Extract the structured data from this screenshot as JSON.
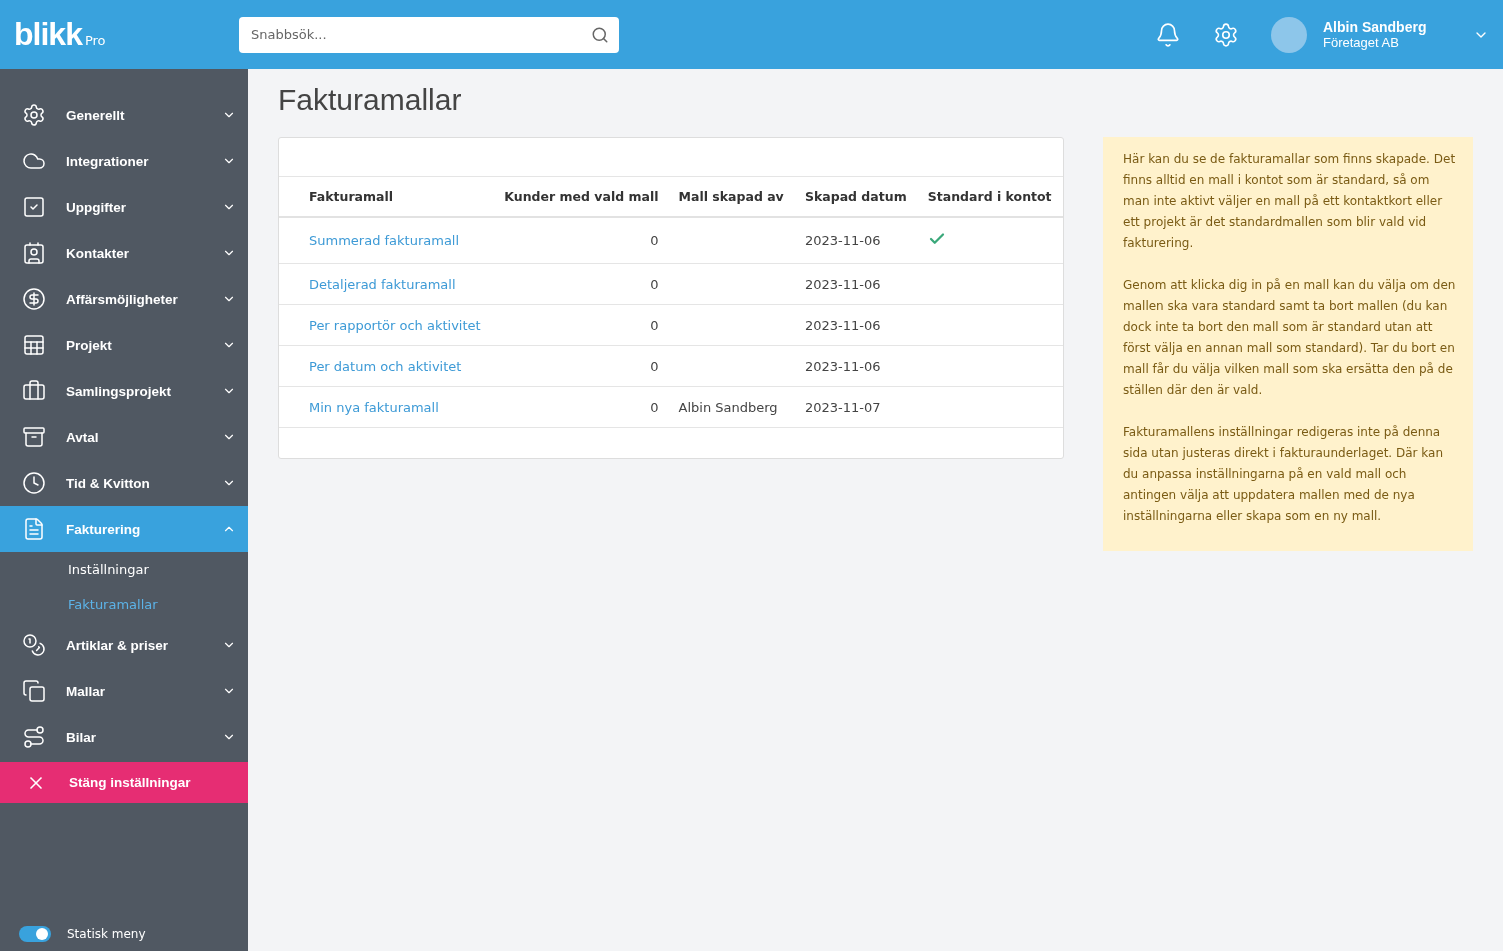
{
  "header": {
    "logo": "blikk",
    "logo_suffix": "Pro",
    "search": {
      "placeholder": "Snabbsök..."
    },
    "user": {
      "name": "Albin Sandberg",
      "company": "Företaget AB"
    }
  },
  "sidebar": {
    "items": [
      {
        "label": "Generellt",
        "expanded": false,
        "selected": false
      },
      {
        "label": "Integrationer",
        "expanded": false,
        "selected": false
      },
      {
        "label": "Uppgifter",
        "expanded": false,
        "selected": false
      },
      {
        "label": "Kontakter",
        "expanded": false,
        "selected": false
      },
      {
        "label": "Affärsmöjligheter",
        "expanded": false,
        "selected": false
      },
      {
        "label": "Projekt",
        "expanded": false,
        "selected": false
      },
      {
        "label": "Samlingsprojekt",
        "expanded": false,
        "selected": false
      },
      {
        "label": "Avtal",
        "expanded": false,
        "selected": false
      },
      {
        "label": "Tid & Kvitton",
        "expanded": false,
        "selected": false
      },
      {
        "label": "Fakturering",
        "expanded": true,
        "selected": true,
        "children": [
          {
            "label": "Inställningar",
            "selected": false
          },
          {
            "label": "Fakturamallar",
            "selected": true
          }
        ]
      },
      {
        "label": "Artiklar & priser",
        "expanded": false,
        "selected": false
      },
      {
        "label": "Mallar",
        "expanded": false,
        "selected": false
      },
      {
        "label": "Bilar",
        "expanded": false,
        "selected": false
      }
    ],
    "close_button": "Stäng inställningar",
    "static_menu": {
      "label": "Statisk meny",
      "on": true
    }
  },
  "page": {
    "title": "Fakturamallar"
  },
  "table": {
    "columns": [
      "Fakturamall",
      "Kunder med vald mall",
      "Mall skapad av",
      "Skapad datum",
      "Standard i kontot"
    ],
    "rows": [
      {
        "name": "Summerad fakturamall",
        "customers": "0",
        "created_by": "",
        "date": "2023-11-06",
        "default": true
      },
      {
        "name": "Detaljerad fakturamall",
        "customers": "0",
        "created_by": "",
        "date": "2023-11-06",
        "default": false
      },
      {
        "name": "Per rapportör och aktivitet",
        "customers": "0",
        "created_by": "",
        "date": "2023-11-06",
        "default": false
      },
      {
        "name": "Per datum och aktivitet",
        "customers": "0",
        "created_by": "",
        "date": "2023-11-06",
        "default": false
      },
      {
        "name": "Min nya fakturamall",
        "customers": "0",
        "created_by": "Albin Sandberg",
        "date": "2023-11-07",
        "default": false
      }
    ]
  },
  "info": {
    "paragraphs": [
      "Här kan du se de fakturamallar som finns skapade. Det finns alltid en mall i kontot som är standard, så om man inte aktivt väljer en mall på ett kontaktkort eller ett projekt är det standardmallen som blir vald vid fakturering.",
      "Genom att klicka dig in på en mall kan du välja om den mallen ska vara standard samt ta bort mallen (du kan dock inte ta bort den mall som är standard utan att först välja en annan mall som standard). Tar du bort en mall får du välja vilken mall som ska ersätta den på de ställen där den är vald.",
      "Fakturamallens inställningar redigeras inte på denna sida utan justeras direkt i fakturaunderlaget. Där kan du anpassa inställningarna på en vald mall och antingen välja att uppdatera mallen med de nya inställningarna eller skapa som en ny mall."
    ]
  }
}
